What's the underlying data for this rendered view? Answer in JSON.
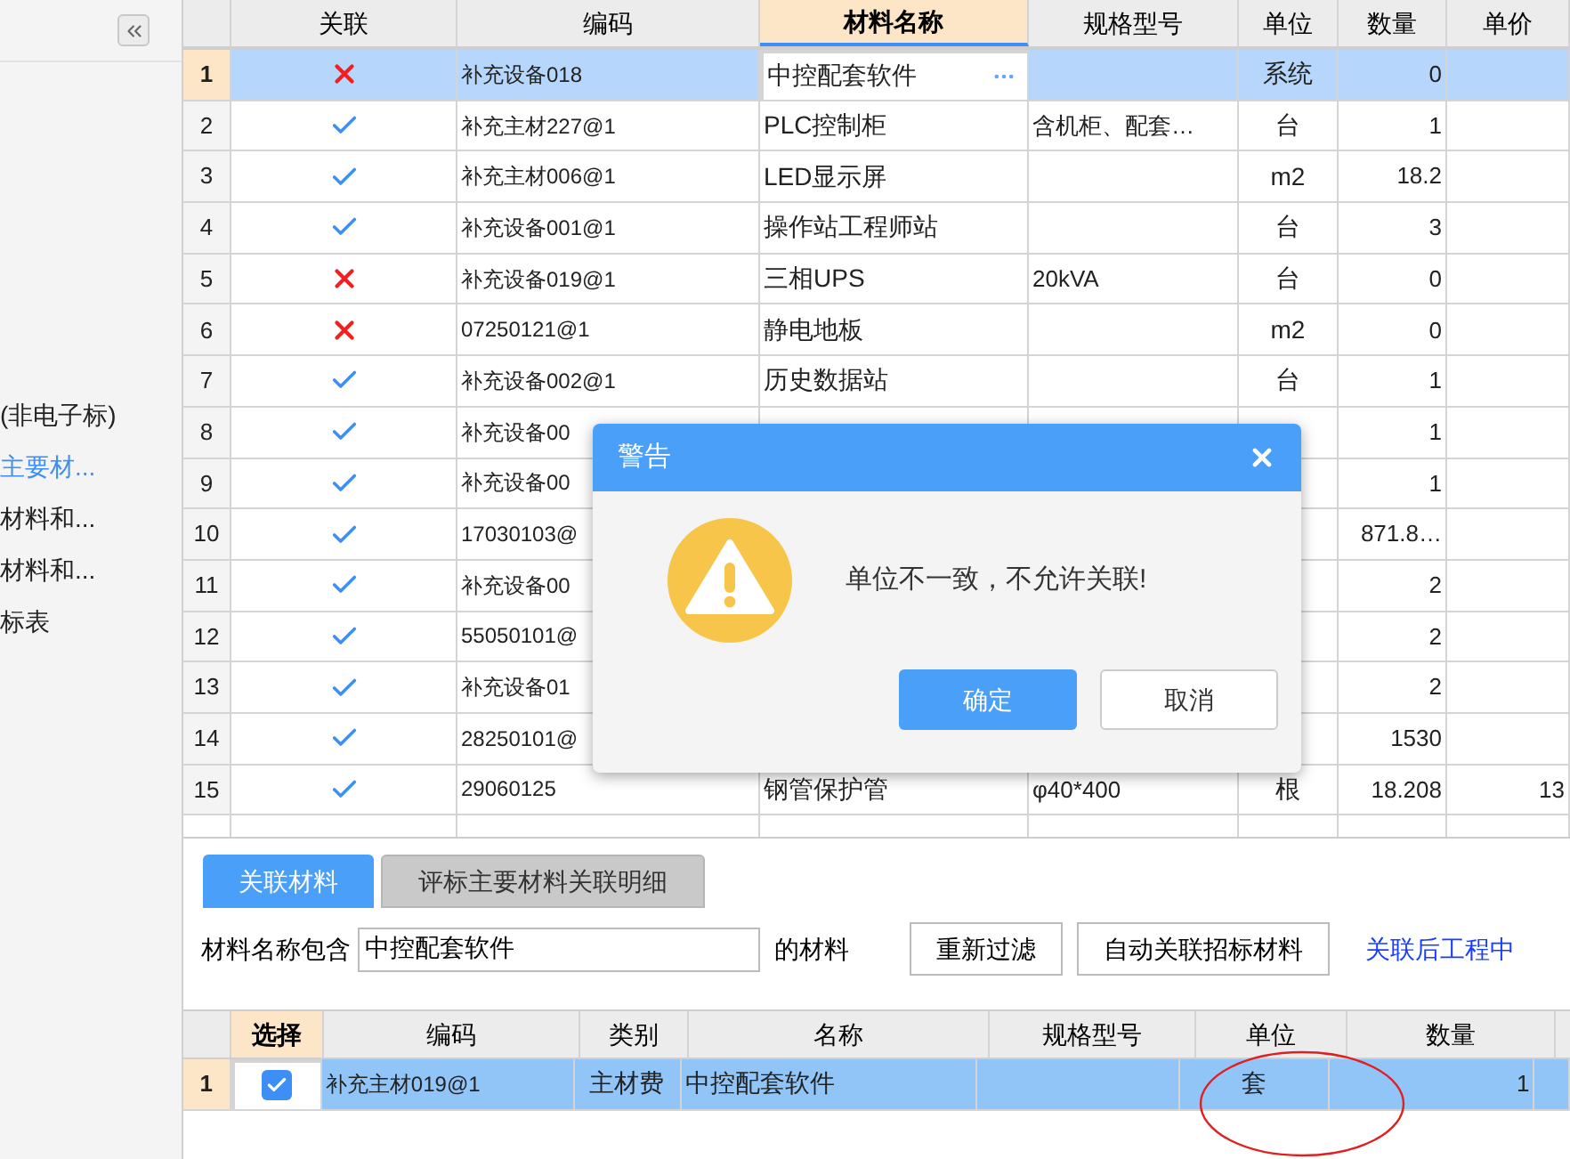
{
  "sidebar": {
    "items": [
      {
        "label": "(非电子标)",
        "selected": false
      },
      {
        "label": "主要材...",
        "selected": true
      },
      {
        "label": "材料和...",
        "selected": false
      },
      {
        "label": "材料和...",
        "selected": false
      },
      {
        "label": "标表",
        "selected": false
      }
    ]
  },
  "table": {
    "columns": [
      "关联",
      "编码",
      "材料名称",
      "规格型号",
      "单位",
      "数量",
      "单价"
    ],
    "rows": [
      {
        "index": "1",
        "selected": true,
        "linked": false,
        "code": "补充设备018",
        "name": "中控配套软件",
        "unit": "系统",
        "qty": "0"
      },
      {
        "index": "2",
        "selected": false,
        "linked": true,
        "code": "补充主材227@1",
        "name": "PLC控制柜",
        "spec": "含机柜、配套…",
        "unit": "台",
        "qty": "1"
      },
      {
        "index": "3",
        "selected": false,
        "linked": true,
        "code": "补充主材006@1",
        "name": "LED显示屏",
        "unit": "m2",
        "qty": "18.2"
      },
      {
        "index": "4",
        "selected": false,
        "linked": true,
        "code": "补充设备001@1",
        "name": "操作站工程师站",
        "unit": "台",
        "qty": "3"
      },
      {
        "index": "5",
        "selected": false,
        "linked": false,
        "code": "补充设备019@1",
        "name": "三相UPS",
        "spec": "20kVA",
        "unit": "台",
        "qty": "0"
      },
      {
        "index": "6",
        "selected": false,
        "linked": false,
        "code": "07250121@1",
        "name": "静电地板",
        "unit": "m2",
        "qty": "0"
      },
      {
        "index": "7",
        "selected": false,
        "linked": true,
        "code": "补充设备002@1",
        "name": "历史数据站",
        "unit": "台",
        "qty": "1"
      },
      {
        "index": "8",
        "selected": false,
        "linked": true,
        "code": "补充设备00",
        "qty": "1"
      },
      {
        "index": "9",
        "selected": false,
        "linked": true,
        "code": "补充设备00",
        "qty": "1"
      },
      {
        "index": "10",
        "selected": false,
        "linked": true,
        "code": "17030103@",
        "qty": "871.8…"
      },
      {
        "index": "11",
        "selected": false,
        "linked": true,
        "code": "补充设备00",
        "qty": "2"
      },
      {
        "index": "12",
        "selected": false,
        "linked": true,
        "code": "55050101@",
        "qty": "2"
      },
      {
        "index": "13",
        "selected": false,
        "linked": true,
        "code": "补充设备01",
        "qty": "2"
      },
      {
        "index": "14",
        "selected": false,
        "linked": true,
        "code": "28250101@",
        "qty": "1530"
      },
      {
        "index": "15",
        "selected": false,
        "linked": true,
        "code": "29060125",
        "name": "钢管保护管",
        "spec": "φ40*400",
        "unit": "根",
        "qty": "18.208",
        "price": "13"
      }
    ]
  },
  "dialog": {
    "title": "警告",
    "message": "单位不一致，不允许关联!",
    "buttons": [
      {
        "label": "确定",
        "primary": true
      },
      {
        "label": "取消",
        "primary": false
      }
    ]
  },
  "bottom_tabs": [
    {
      "label": "关联材料",
      "selected": true
    },
    {
      "label": "评标主要材料关联明细",
      "selected": false
    }
  ],
  "filter": {
    "label": "材料名称包含",
    "value": "中控配套软件",
    "suffix": "的材料",
    "buttons": [
      "重新过滤",
      "自动关联招标材料"
    ],
    "link": "关联后工程中"
  },
  "lower_table": {
    "columns": [
      "选择",
      "编码",
      "类别",
      "名称",
      "规格型号",
      "单位",
      "数量"
    ],
    "rows": [
      {
        "index": "1",
        "checked": true,
        "code": "补充主材019@1",
        "category": "主材费",
        "name": "中控配套软件",
        "unit": "套",
        "qty": "1"
      }
    ]
  }
}
